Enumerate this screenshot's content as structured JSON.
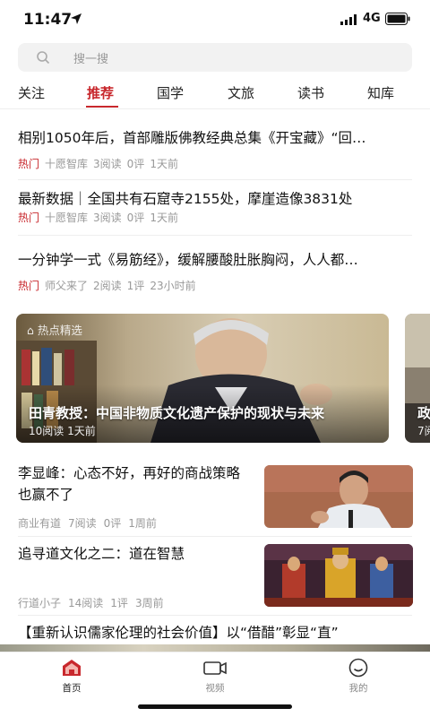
{
  "status": {
    "time": "11:47",
    "network": "4G"
  },
  "search": {
    "placeholder": "搜一搜"
  },
  "tabs": [
    {
      "label": "关注"
    },
    {
      "label": "推荐"
    },
    {
      "label": "国学"
    },
    {
      "label": "文旅"
    },
    {
      "label": "读书"
    },
    {
      "label": "知库"
    }
  ],
  "active_tab": "推荐",
  "news": [
    {
      "title": "相别1050年后，首部雕版佛教经典总集《开宝藏》“回…",
      "tag": "热门",
      "source": "十愿智库",
      "reads": "3阅读",
      "comments": "0评",
      "time": "1天前"
    },
    {
      "title": "最新数据｜全国共有石窟寺2155处，摩崖造像3831处",
      "tag": "热门",
      "source": "十愿智库",
      "reads": "3阅读",
      "comments": "0评",
      "time": "1天前"
    },
    {
      "title": "一分钟学一式《易筋经》，缓解腰酸肚胀胸闷，人人都…",
      "tag": "热门",
      "source": "师父来了",
      "reads": "2阅读",
      "comments": "1评",
      "time": "23小时前"
    }
  ],
  "carousel": {
    "badge": "热点精选",
    "cards": [
      {
        "title": "田青教授：中国非物质文化遗产保护的现状与未来",
        "reads": "10阅读",
        "time": "1天前"
      },
      {
        "title": "政",
        "reads": "7阅",
        "time": ""
      }
    ]
  },
  "articles": [
    {
      "title": "李显峰：心态不好，再好的商战策略也赢不了",
      "source": "商业有道",
      "reads": "7阅读",
      "comments": "0评",
      "time": "1周前"
    },
    {
      "title": "追寻道文化之二：道在智慧",
      "source": "行道小子",
      "reads": "14阅读",
      "comments": "1评",
      "time": "3周前"
    }
  ],
  "last_title": "【重新认识儒家伦理的社会价值】以“借醋”彰显“直”",
  "bottom_nav": [
    {
      "label": "首页",
      "icon": "home-icon"
    },
    {
      "label": "视频",
      "icon": "video-icon"
    },
    {
      "label": "我的",
      "icon": "profile-icon"
    }
  ],
  "colors": {
    "accent": "#c8282d"
  }
}
